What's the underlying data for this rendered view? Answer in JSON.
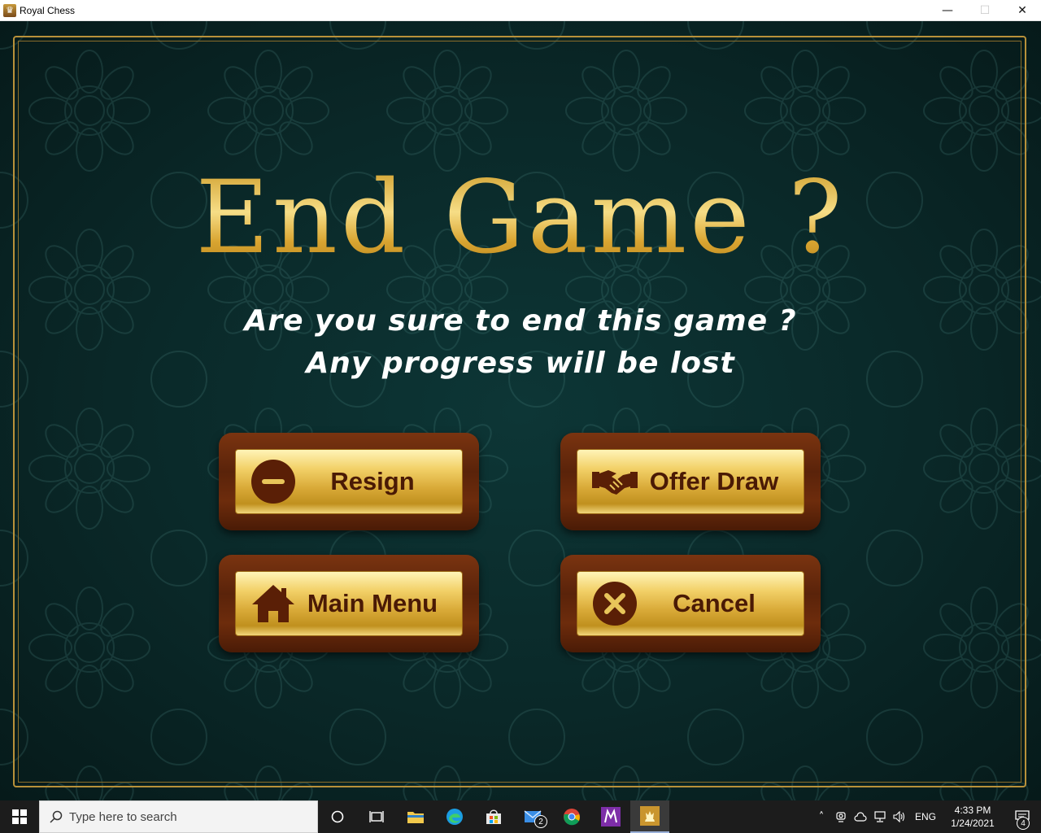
{
  "window": {
    "title": "Royal Chess",
    "minimize": "—",
    "maximize": "☐",
    "close": "✕"
  },
  "dialog": {
    "heading": "End Game ?",
    "line1": "Are you sure to end this game ?",
    "line2": "Any progress will be lost",
    "buttons": {
      "resign": "Resign",
      "offer_draw": "Offer Draw",
      "main_menu": "Main Menu",
      "cancel": "Cancel"
    },
    "colors": {
      "gold": "#e2b84a",
      "wood": "#6b2b0c",
      "label": "#4a1a05",
      "background": "#0a2828"
    }
  },
  "taskbar": {
    "search_placeholder": "Type here to search",
    "mail_badge": "2",
    "language": "ENG",
    "time": "4:33 PM",
    "date": "1/24/2021",
    "notification_count": "4"
  }
}
